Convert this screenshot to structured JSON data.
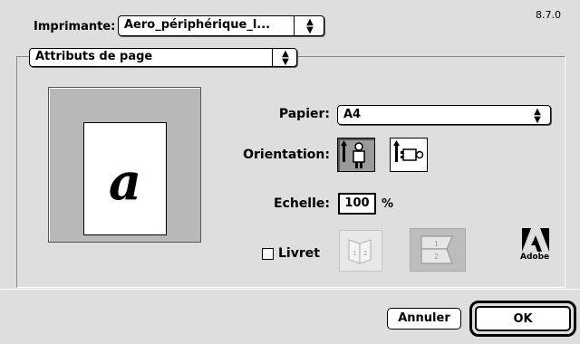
{
  "header": {
    "printer_label": "Imprimante:",
    "printer_value": "Aero_périphérique_l...",
    "version": "8.7.0"
  },
  "section_popup": {
    "value": "Attributs de page"
  },
  "preview": {
    "glyph": "a"
  },
  "form": {
    "paper_label": "Papier:",
    "paper_value": "A4",
    "orientation_label": "Orientation:",
    "orientation_selected": "portrait",
    "scale_label": "Echelle:",
    "scale_value": "100",
    "scale_unit": "%",
    "booklet_label": "Livret",
    "booklet_checked": false
  },
  "brand": {
    "logo_text": "Adobe"
  },
  "buttons": {
    "cancel": "Annuler",
    "ok": "OK"
  },
  "icons": {
    "portrait": "portrait-orientation-icon",
    "landscape": "landscape-orientation-icon",
    "booklet_left": "booklet-left-binding-icon",
    "booklet_right": "booklet-right-binding-icon"
  }
}
